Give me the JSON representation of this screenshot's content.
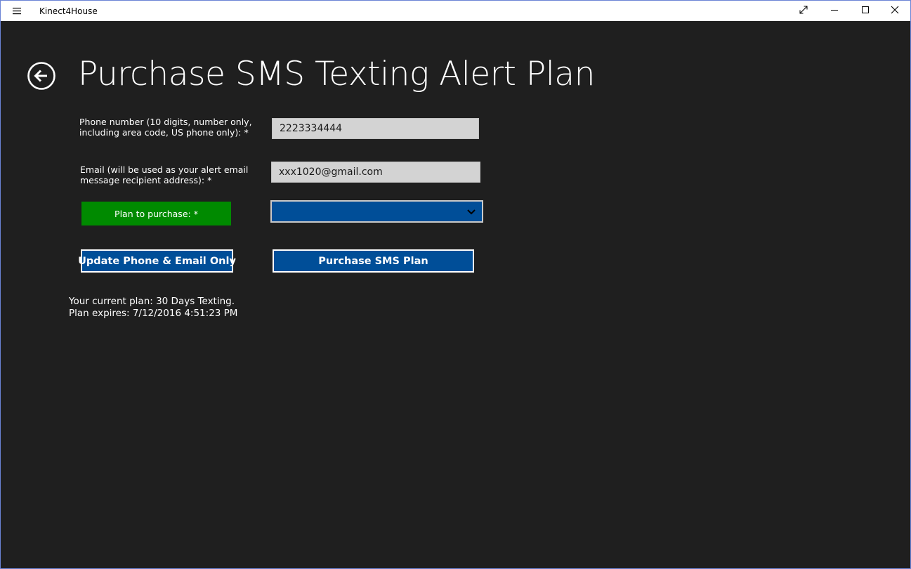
{
  "window": {
    "title": "Kinect4House",
    "buttons": {
      "menu_icon": "hamburger-icon",
      "fullscreen_icon": "expand-diagonal-icon",
      "minimize_icon": "minimize-icon",
      "maximize_icon": "maximize-icon",
      "close_icon": "close-icon"
    }
  },
  "page": {
    "back_icon": "back-arrow-circle-icon",
    "title": "Purchase SMS Texting Alert Plan"
  },
  "form": {
    "phone": {
      "label_line1": "Phone number (10 digits, number only,",
      "label_line2": "including area code, US phone only): *",
      "value": "2223334444"
    },
    "email": {
      "label_line1": "Email (will be used as your alert email",
      "label_line2": "message recipient address): *",
      "value": "xxx1020@gmail.com"
    },
    "plan": {
      "label": "Plan to purchase: *",
      "selected": "",
      "chevron_icon": "chevron-down-icon"
    }
  },
  "actions": {
    "update_label": "Update Phone & Email Only",
    "purchase_label": "Purchase SMS Plan"
  },
  "status": {
    "current_plan": "Your current plan: 30 Days Texting.",
    "expires": "Plan expires: 7/12/2016 4:51:23 PM"
  },
  "colors": {
    "background": "#1f1f1f",
    "accent_blue": "#004e98",
    "label_green": "#008a00",
    "textbox_gray": "#d3d3d3",
    "window_border": "#6b84d6"
  }
}
